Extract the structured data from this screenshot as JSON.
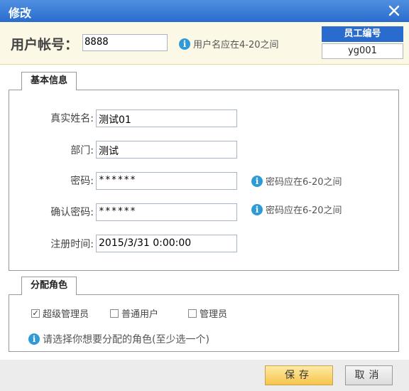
{
  "window": {
    "title": "修改",
    "close_icon": "close-icon"
  },
  "header": {
    "account_label": "用户帐号：",
    "account_value": "8888",
    "account_hint": "用户名应在4-20之间",
    "employee_label": "员工编号",
    "employee_value": "yg001"
  },
  "basic_info": {
    "tab_label": "基本信息",
    "real_name_label": "真实姓名:",
    "real_name_value": "测试01",
    "department_label": "部门:",
    "department_value": "测试",
    "password_label": "密码:",
    "password_value": "******",
    "password_hint": "密码应在6-20之间",
    "confirm_label": "确认密码:",
    "confirm_value": "******",
    "confirm_hint": "密码应在6-20之间",
    "register_label": "注册时间:",
    "register_value": "2015/3/31 0:00:00"
  },
  "roles": {
    "tab_label": "分配角色",
    "options": [
      {
        "label": "超级管理员",
        "checked": true
      },
      {
        "label": "普通用户",
        "checked": false
      },
      {
        "label": "管理员",
        "checked": false
      }
    ],
    "hint": "请选择你想要分配的角色(至少选一个)"
  },
  "footer": {
    "save_label": "保存",
    "cancel_label": "取消"
  },
  "colors": {
    "titlebar": "#2a6ccd",
    "header_bg": "#fcf8e6",
    "info_icon": "#2f9ad8",
    "save_button": "#f6c449"
  }
}
